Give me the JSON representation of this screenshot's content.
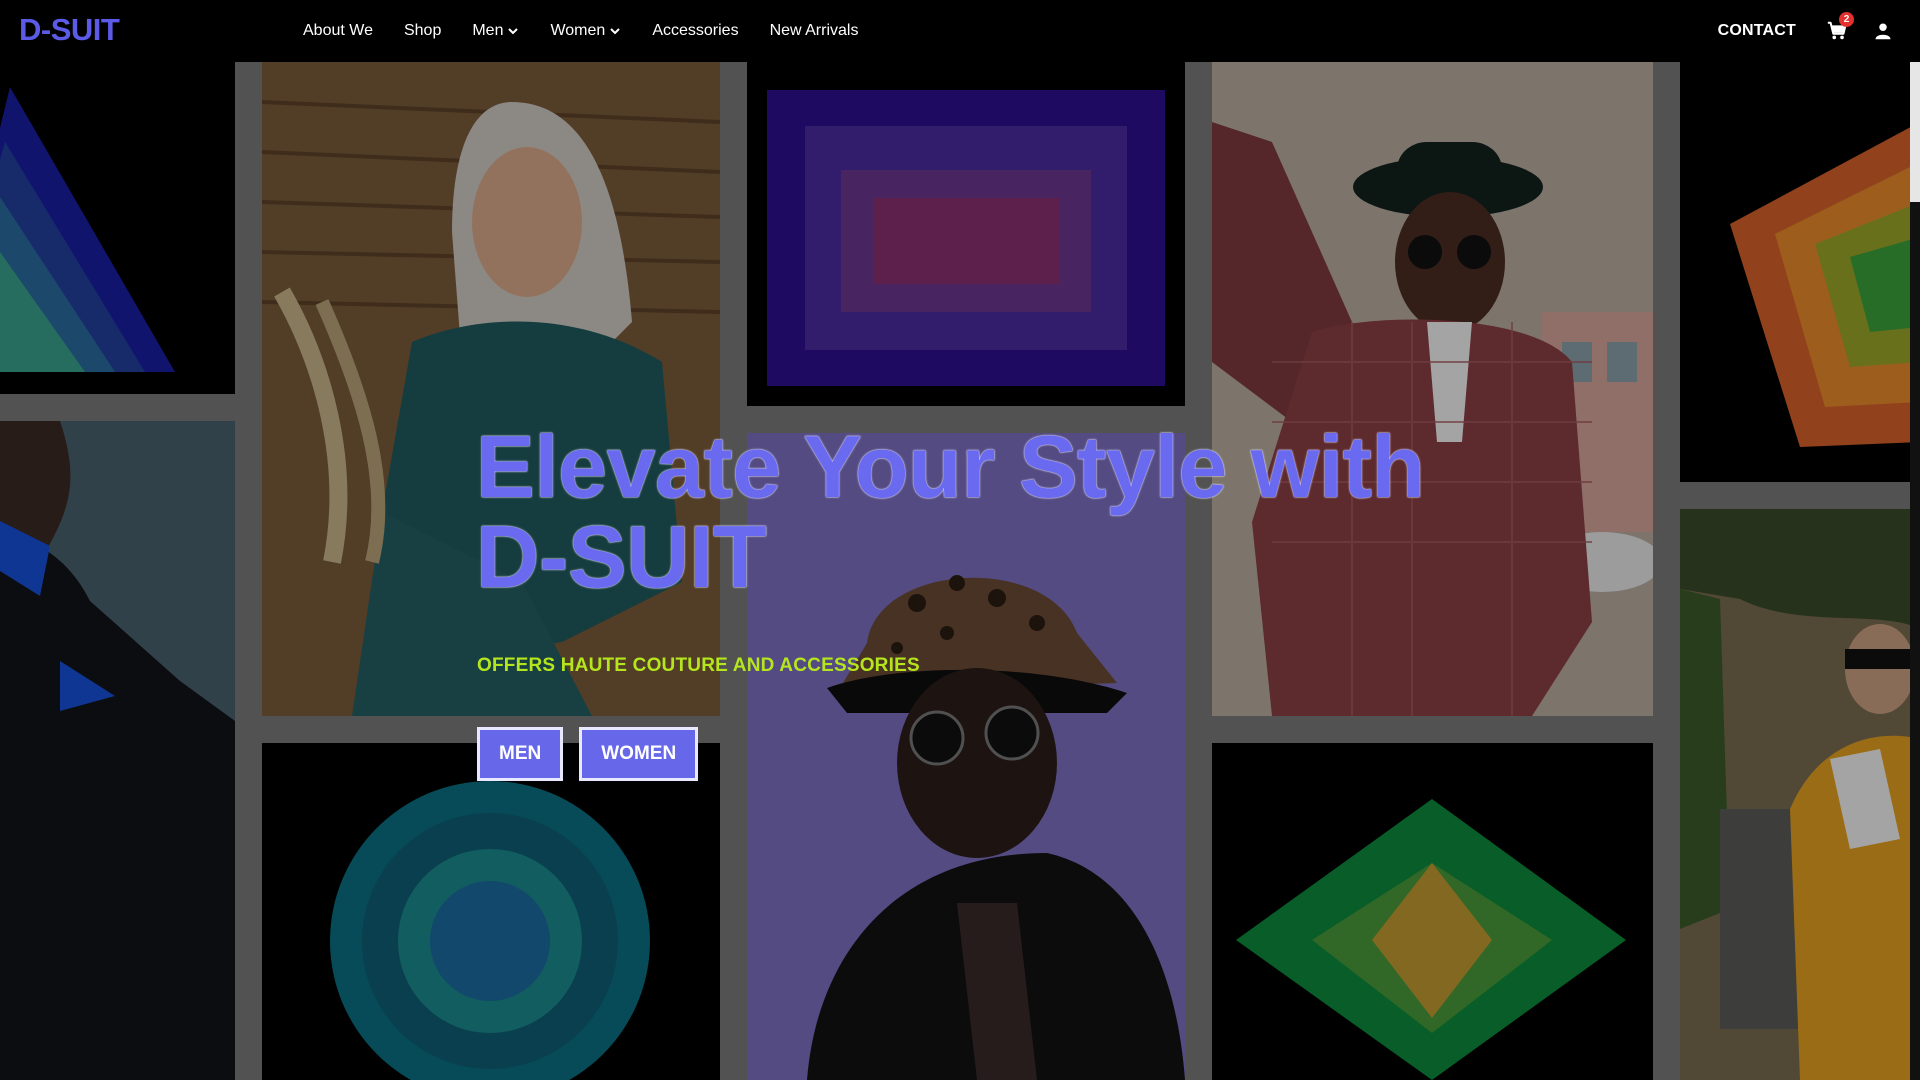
{
  "brand": {
    "logo": "D-SUIT",
    "accent": "#5b5be8"
  },
  "nav": {
    "items": [
      {
        "label": "About We",
        "dropdown": false
      },
      {
        "label": "Shop",
        "dropdown": false
      },
      {
        "label": "Men",
        "dropdown": true
      },
      {
        "label": "Women",
        "dropdown": true
      },
      {
        "label": "Accessories",
        "dropdown": false
      },
      {
        "label": "New Arrivals",
        "dropdown": false
      }
    ],
    "contact": "CONTACT",
    "cart_count": "2",
    "icons": {
      "cart": "cart-icon",
      "user": "user-icon",
      "chevron": "chevron-down-icon"
    }
  },
  "hero": {
    "title_line1": "Elevate Your Style with",
    "title_line2": "D-SUIT",
    "subtitle": "OFFERS HAUTE COUTURE AND ACCESSORIES",
    "buttons": [
      "MEN",
      "WOMEN"
    ],
    "title_color": "#6a6af0",
    "subtitle_color": "#b5e61d"
  },
  "colors": {
    "nav_bg": "#000000",
    "button_bg": "#6767ea",
    "badge": "#e53030"
  }
}
